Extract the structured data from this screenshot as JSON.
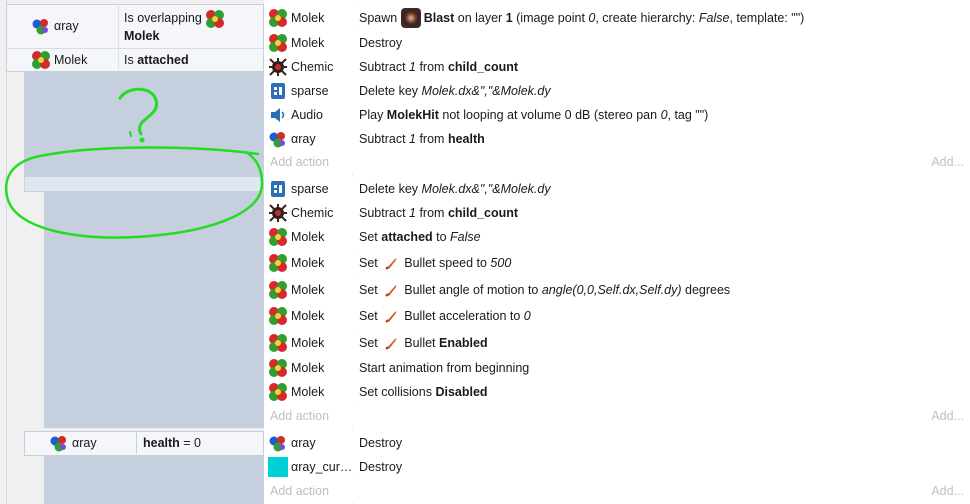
{
  "events": {
    "event1": {
      "conditions": [
        {
          "object": "αray",
          "text_before": "Is overlapping",
          "target": "Molek",
          "bold_part": ""
        },
        {
          "object": "Molek",
          "text_before": "Is ",
          "bold_part": "attached"
        }
      ],
      "actions": [
        {
          "object": "Molek",
          "icon": "molek",
          "parts": [
            "Spawn ",
            "Blast",
            " on layer ",
            "1",
            " (image point ",
            "0",
            ", create hierarchy: ",
            "False",
            ", template: \"\")"
          ]
        },
        {
          "object": "Molek",
          "icon": "molek",
          "text": "Destroy"
        },
        {
          "object": "Chemic",
          "icon": "chemic",
          "parts": [
            "Subtract ",
            "1",
            " from ",
            "child_count"
          ]
        },
        {
          "object": "sparse",
          "icon": "sparse",
          "parts": [
            "Delete key ",
            "Molek.dx&\",\"&Molek.dy"
          ]
        },
        {
          "object": "Audio",
          "icon": "audio",
          "parts": [
            "Play ",
            "MolekHit",
            " not looping at volume 0 dB (stereo pan ",
            "0",
            ", tag \"\")"
          ]
        },
        {
          "object": "αray",
          "icon": "aray",
          "parts": [
            "Subtract ",
            "1",
            " from ",
            "health"
          ]
        }
      ]
    },
    "event2": {
      "actions": [
        {
          "object": "sparse",
          "icon": "sparse",
          "parts": [
            "Delete key ",
            "Molek.dx&\",\"&Molek.dy"
          ]
        },
        {
          "object": "Chemic",
          "icon": "chemic",
          "parts": [
            "Subtract ",
            "1",
            " from ",
            "child_count"
          ]
        },
        {
          "object": "Molek",
          "icon": "molek",
          "parts": [
            "Set ",
            "attached",
            " to ",
            "False"
          ]
        },
        {
          "object": "Molek",
          "icon": "molek",
          "parts": [
            "Set ",
            "Bullet speed to ",
            "500"
          ]
        },
        {
          "object": "Molek",
          "icon": "molek",
          "parts": [
            "Set ",
            "Bullet angle of motion to ",
            "angle(0,0,Self.dx,Self.dy)",
            " degrees"
          ]
        },
        {
          "object": "Molek",
          "icon": "molek",
          "parts": [
            "Set ",
            "Bullet acceleration to ",
            "0"
          ]
        },
        {
          "object": "Molek",
          "icon": "molek",
          "parts": [
            "Set ",
            "Bullet ",
            "Enabled"
          ]
        },
        {
          "object": "Molek",
          "icon": "molek",
          "text": "Start animation from beginning"
        },
        {
          "object": "Molek",
          "icon": "molek",
          "parts": [
            "Set collisions ",
            "Disabled"
          ]
        }
      ]
    },
    "event3": {
      "condition": {
        "object": "αray",
        "bold_part": "health",
        "text_after": " = 0"
      },
      "actions": [
        {
          "object": "αray",
          "icon": "aray",
          "text": "Destroy"
        },
        {
          "object": "αray_cur…",
          "icon": "cyan-square",
          "text": "Destroy"
        }
      ]
    }
  },
  "add_action_label": "Add action",
  "add_action_short": "Add...",
  "annotation": {
    "mark": "?",
    "color": "#22dd22"
  },
  "colors": {
    "group_bg": "#c5cfdd",
    "selection_bg": "#dfe7f1",
    "add_action_text": "#c0c0c0",
    "cyan": "#00d0d8"
  }
}
